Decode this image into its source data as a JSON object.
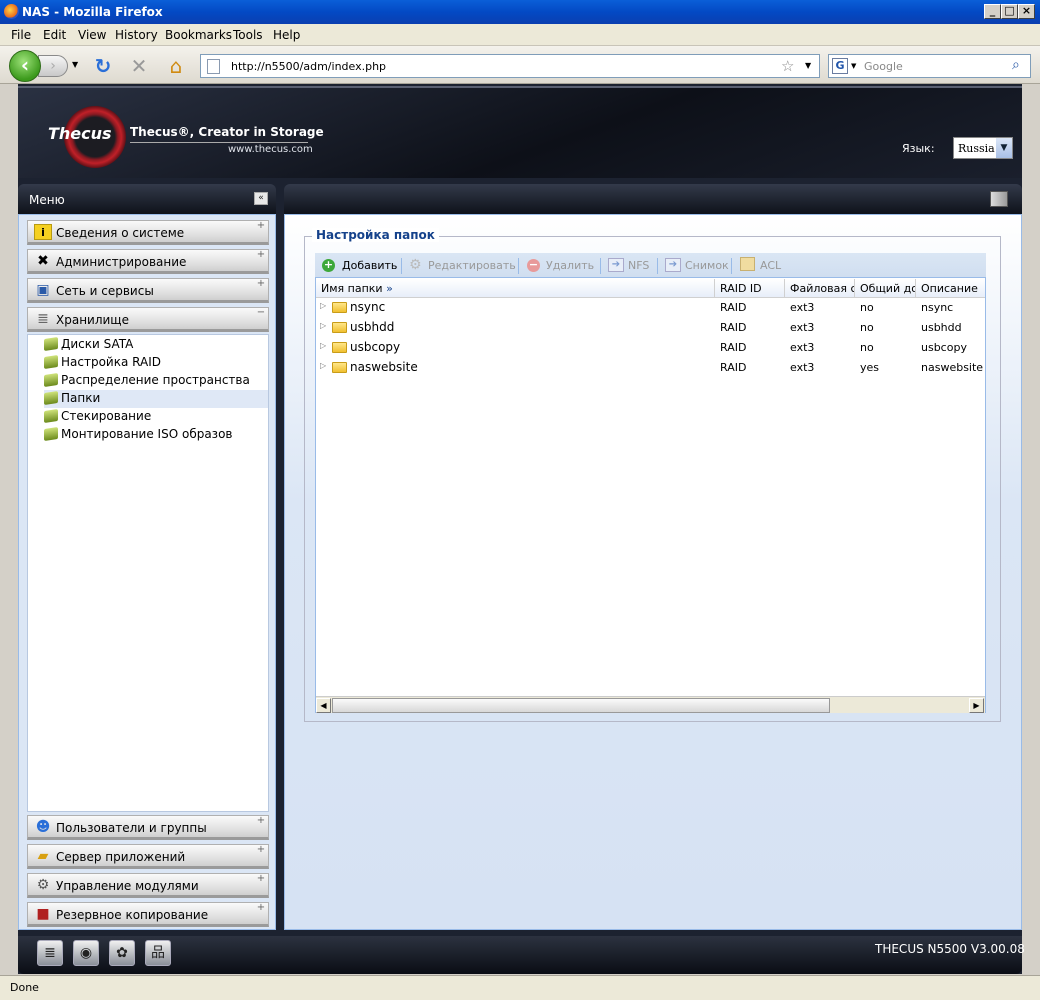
{
  "browser": {
    "title": "NAS - Mozilla Firefox",
    "menu": [
      "File",
      "Edit",
      "View",
      "History",
      "Bookmarks",
      "Tools",
      "Help"
    ],
    "url": "http://n5500/adm/index.php",
    "search_placeholder": "Google",
    "status": "Done"
  },
  "header": {
    "logo": "Thecus",
    "tagline": "Thecus®, Creator in Storage",
    "site": "www.thecus.com",
    "lang_label": "Язык:",
    "lang_value": "Russia"
  },
  "sidebar": {
    "title": "Меню",
    "sections_top": [
      {
        "label": "Сведения о системе",
        "icon": "info-icon"
      },
      {
        "label": "Администрирование",
        "icon": "tools-icon"
      },
      {
        "label": "Сеть и сервисы",
        "icon": "network-icon"
      },
      {
        "label": "Хранилище",
        "icon": "storage-icon"
      }
    ],
    "storage_items": [
      "Диски SATA",
      "Настройка RAID",
      "Распределение пространства",
      "Папки",
      "Стекирование",
      "Монтирование ISO образов"
    ],
    "selected_item": "Папки",
    "sections_bottom": [
      {
        "label": "Пользователи и группы",
        "icon": "users-icon"
      },
      {
        "label": "Сервер приложений",
        "icon": "app-server-icon"
      },
      {
        "label": "Управление модулями",
        "icon": "modules-icon"
      },
      {
        "label": "Резервное копирование",
        "icon": "backup-icon"
      }
    ]
  },
  "main": {
    "panel_title": "Настройка папок",
    "toolbar": {
      "add": "Добавить",
      "edit": "Редактировать",
      "delete": "Удалить",
      "nfs": "NFS",
      "snapshot": "Снимок",
      "acl": "ACL"
    },
    "columns": [
      "Имя папки",
      "RAID ID",
      "Файловая си",
      "Общий дос",
      "Описание"
    ],
    "rows": [
      {
        "name": "nsync",
        "raid": "RAID",
        "fs": "ext3",
        "public": "no",
        "desc": "nsync"
      },
      {
        "name": "usbhdd",
        "raid": "RAID",
        "fs": "ext3",
        "public": "no",
        "desc": "usbhdd"
      },
      {
        "name": "usbcopy",
        "raid": "RAID",
        "fs": "ext3",
        "public": "no",
        "desc": "usbcopy"
      },
      {
        "name": "naswebsite",
        "raid": "RAID",
        "fs": "ext3",
        "public": "yes",
        "desc": "naswebsite"
      }
    ]
  },
  "footer": {
    "version": "THECUS N5500 V3.00.08"
  }
}
